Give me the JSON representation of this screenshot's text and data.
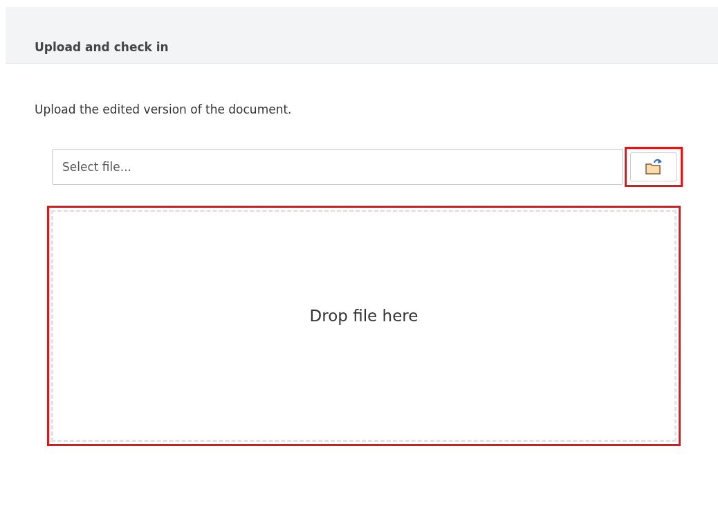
{
  "header": {
    "title": "Upload and check in"
  },
  "description": "Upload the edited version of the document.",
  "file_field": {
    "placeholder": "Select file..."
  },
  "browse_button": {
    "highlighted": true
  },
  "drop_zone": {
    "label": "Drop file here",
    "highlighted": true
  }
}
